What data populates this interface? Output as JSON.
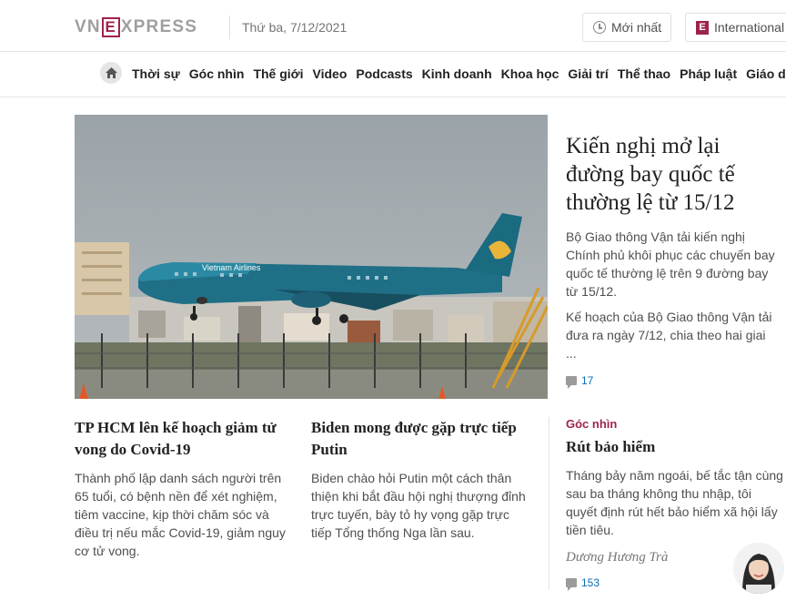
{
  "header": {
    "logo_left": "VN",
    "logo_e": "E",
    "logo_right": "XPRESS",
    "date": "Thứ ba, 7/12/2021",
    "latest_label": "Mới nhất",
    "international_label": "International"
  },
  "nav": {
    "items": [
      "Thời sự",
      "Góc nhìn",
      "Thế giới",
      "Video",
      "Podcasts",
      "Kinh doanh",
      "Khoa học",
      "Giải trí",
      "Thể thao",
      "Pháp luật",
      "Giáo dục"
    ]
  },
  "hero": {
    "title": "Kiến nghị mở lại đường bay quốc tế thường lệ từ 15/12",
    "desc1": "Bộ Giao thông Vận tải kiến nghị Chính phủ khôi phục các chuyến bay quốc tế thường lệ trên 9 đường bay từ 15/12.",
    "desc2": "Kế hoạch của Bộ Giao thông Vận tải đưa ra ngày 7/12, chia theo hai giai ...",
    "comments": "17",
    "image_text": "Vietnam Airlines"
  },
  "cards": [
    {
      "title": "TP HCM lên kế hoạch giảm tử vong do Covid-19",
      "desc": "Thành phố lập danh sách người trên 65 tuổi, có bệnh nền để xét nghiệm, tiêm vaccine, kịp thời chăm sóc và điều trị nếu mắc Covid-19, giảm nguy cơ tử vong."
    },
    {
      "title": "Biden mong được gặp trực tiếp Putin",
      "desc": "Biden chào hỏi Putin một cách thân thiện khi bắt đầu hội nghị thượng đỉnh trực tuyến, bày tỏ hy vọng gặp trực tiếp Tổng thống Nga lần sau."
    }
  ],
  "opinion": {
    "tag": "Góc nhìn",
    "title": "Rút bảo hiểm",
    "desc": "Tháng bảy năm ngoái, bế tắc tận cùng sau ba tháng không thu nhập, tôi quyết định rút hết bảo hiểm xã hội lấy tiền tiêu.",
    "author": "Dương Hương Trà",
    "comments": "153"
  },
  "colors": {
    "brand": "#9f224e",
    "link": "#076db6",
    "text": "#222222",
    "muted": "#4f4f4f"
  }
}
